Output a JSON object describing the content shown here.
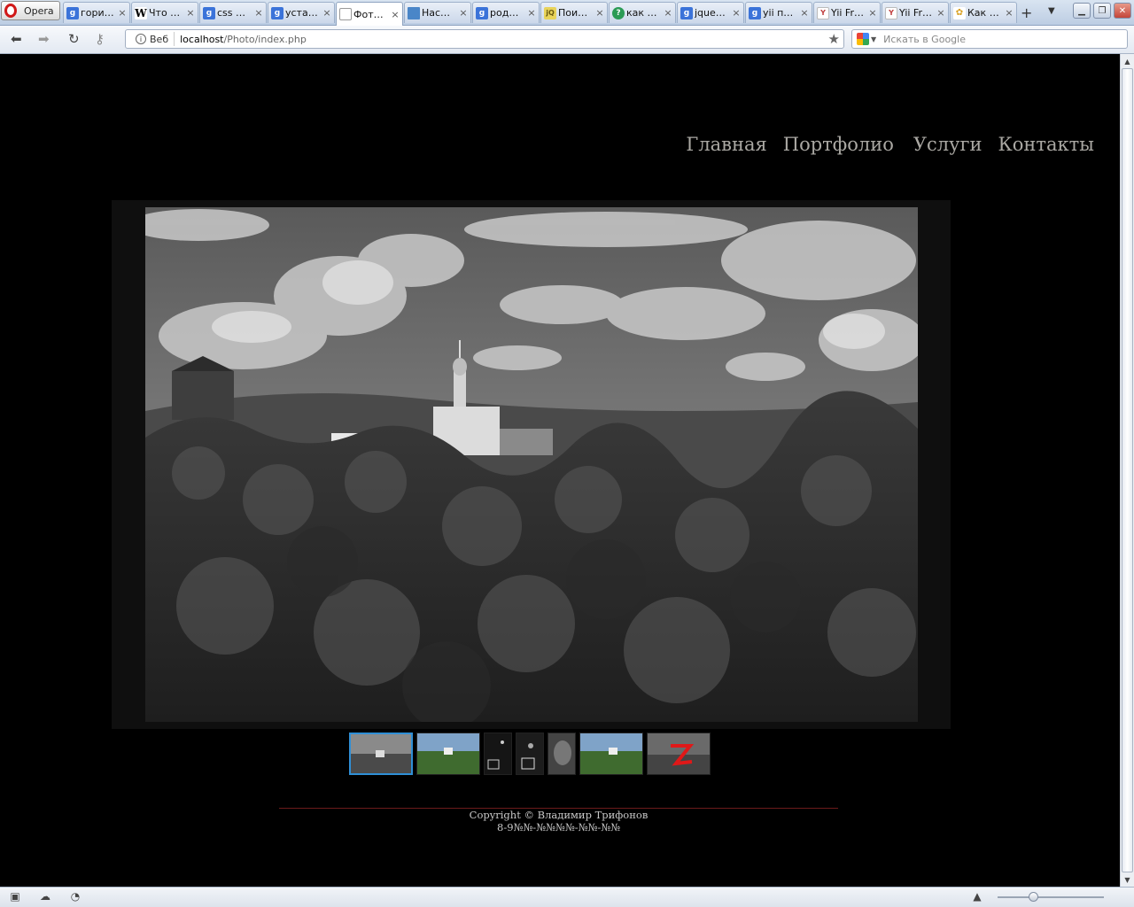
{
  "browser": {
    "menu_label": "Opera",
    "tabs": [
      {
        "title": "гори…",
        "icon": "google-icon"
      },
      {
        "title": "Что …",
        "icon": "wikipedia-icon"
      },
      {
        "title": "css …",
        "icon": "google-icon"
      },
      {
        "title": "уста…",
        "icon": "google-icon"
      },
      {
        "title": "Фот…",
        "icon": "page-icon",
        "active": true
      },
      {
        "title": "Нас…",
        "icon": "monitor-icon"
      },
      {
        "title": "род…",
        "icon": "google-icon"
      },
      {
        "title": "Пои…",
        "icon": "jquery-icon"
      },
      {
        "title": "как …",
        "icon": "question-icon"
      },
      {
        "title": "jque…",
        "icon": "google-icon"
      },
      {
        "title": "yii п…",
        "icon": "google-icon"
      },
      {
        "title": "Yii Fr…",
        "icon": "yii-icon"
      },
      {
        "title": "Yii Fr…",
        "icon": "yii-icon"
      },
      {
        "title": "Как …",
        "icon": "flower-icon"
      }
    ],
    "address": {
      "badge": "Веб",
      "host": "localhost",
      "path": "/Photo/index.php"
    },
    "search_placeholder": "Искать в Google",
    "tab_close_glyph": "×"
  },
  "site": {
    "nav": [
      "Главная",
      "Портфолио",
      "Услуги",
      "Контакты"
    ],
    "thumbnails_count": 7,
    "selected_thumbnail": 1,
    "footer": {
      "copyright": "Copyright © Владимир Трифонов",
      "phone": "8-9№№-№№№№-№№-№№"
    }
  },
  "colors": {
    "page_bg": "#000000",
    "nav_text": "#aaa8a3",
    "thumb_selected_border": "#2f8fd6",
    "footer_rule": "#6b1b1b"
  }
}
